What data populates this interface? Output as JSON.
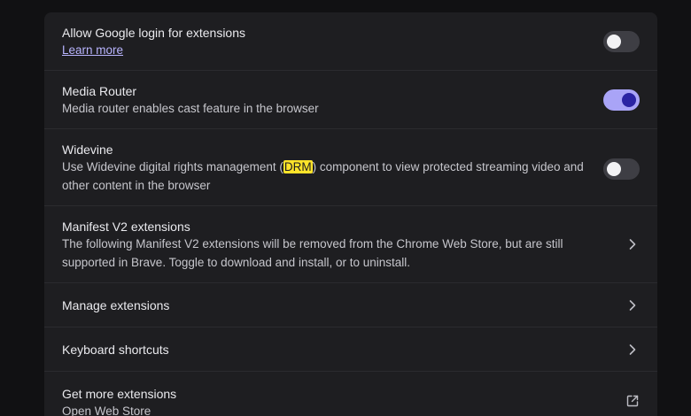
{
  "settings": {
    "rows": [
      {
        "title": "Allow Google login for extensions",
        "link": "Learn more",
        "control": "toggle",
        "enabled": false
      },
      {
        "title": "Media Router",
        "description": "Media router enables cast feature in the browser",
        "control": "toggle",
        "enabled": true
      },
      {
        "title": "Widevine",
        "description_pre": "Use Widevine digital rights management (",
        "description_highlight": "DRM",
        "description_post": ") component to view protected streaming video and other content in the browser",
        "control": "toggle",
        "enabled": false
      },
      {
        "title": "Manifest V2 extensions",
        "description": "The following Manifest V2 extensions will be removed from the Chrome Web Store, but are still supported in Brave. Toggle to download and install, or to uninstall.",
        "control": "chevron-right-icon"
      },
      {
        "title": "Manage extensions",
        "control": "chevron-right-icon"
      },
      {
        "title": "Keyboard shortcuts",
        "control": "chevron-right-icon"
      },
      {
        "title": "Get more extensions",
        "description": "Open Web Store",
        "control": "external-link-icon"
      }
    ]
  },
  "colors": {
    "page_background": "#111113",
    "card_background": "#1e1e21",
    "toggle_on": "#a9a4f7",
    "toggle_off": "#3e3e44",
    "link": "#b9b5ff",
    "highlight": "#ffe32a"
  }
}
